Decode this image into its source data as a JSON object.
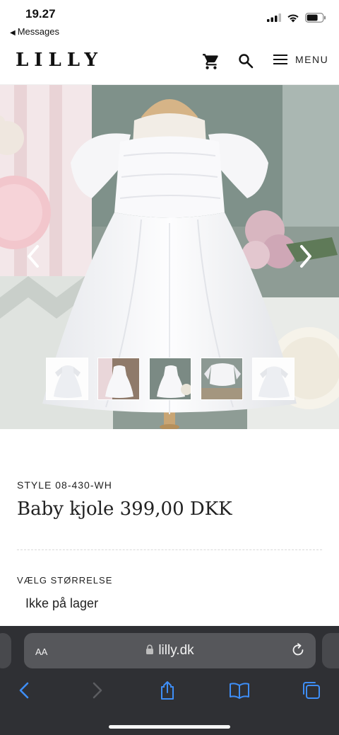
{
  "status_bar": {
    "time": "19.27",
    "back_label": "Messages",
    "icons": [
      "signal-icon",
      "wifi-icon",
      "battery-icon"
    ]
  },
  "header": {
    "logo": "LILLY",
    "menu_label": "MENU",
    "icons": [
      "cart-icon",
      "search-icon",
      "hamburger-icon"
    ]
  },
  "gallery": {
    "image_count": 5,
    "selected_index": 0,
    "colors": {
      "background": "#8a9a92",
      "dress": "#f8f8fa"
    }
  },
  "product": {
    "style": "STYLE 08-430-WH",
    "title": "Baby kjole 399,00 DKK",
    "size_label": "VÆLG STØRRELSE",
    "stock_status": "Ikke på lager"
  },
  "browser": {
    "aa_label": "AA",
    "url": "lilly.dk",
    "toolbar_icons": [
      "back-icon",
      "forward-icon",
      "share-icon",
      "bookmarks-icon",
      "tabs-icon"
    ],
    "colors": {
      "bar": "#2f3034",
      "address": "#56575b",
      "accent": "#3e8ef7"
    }
  }
}
